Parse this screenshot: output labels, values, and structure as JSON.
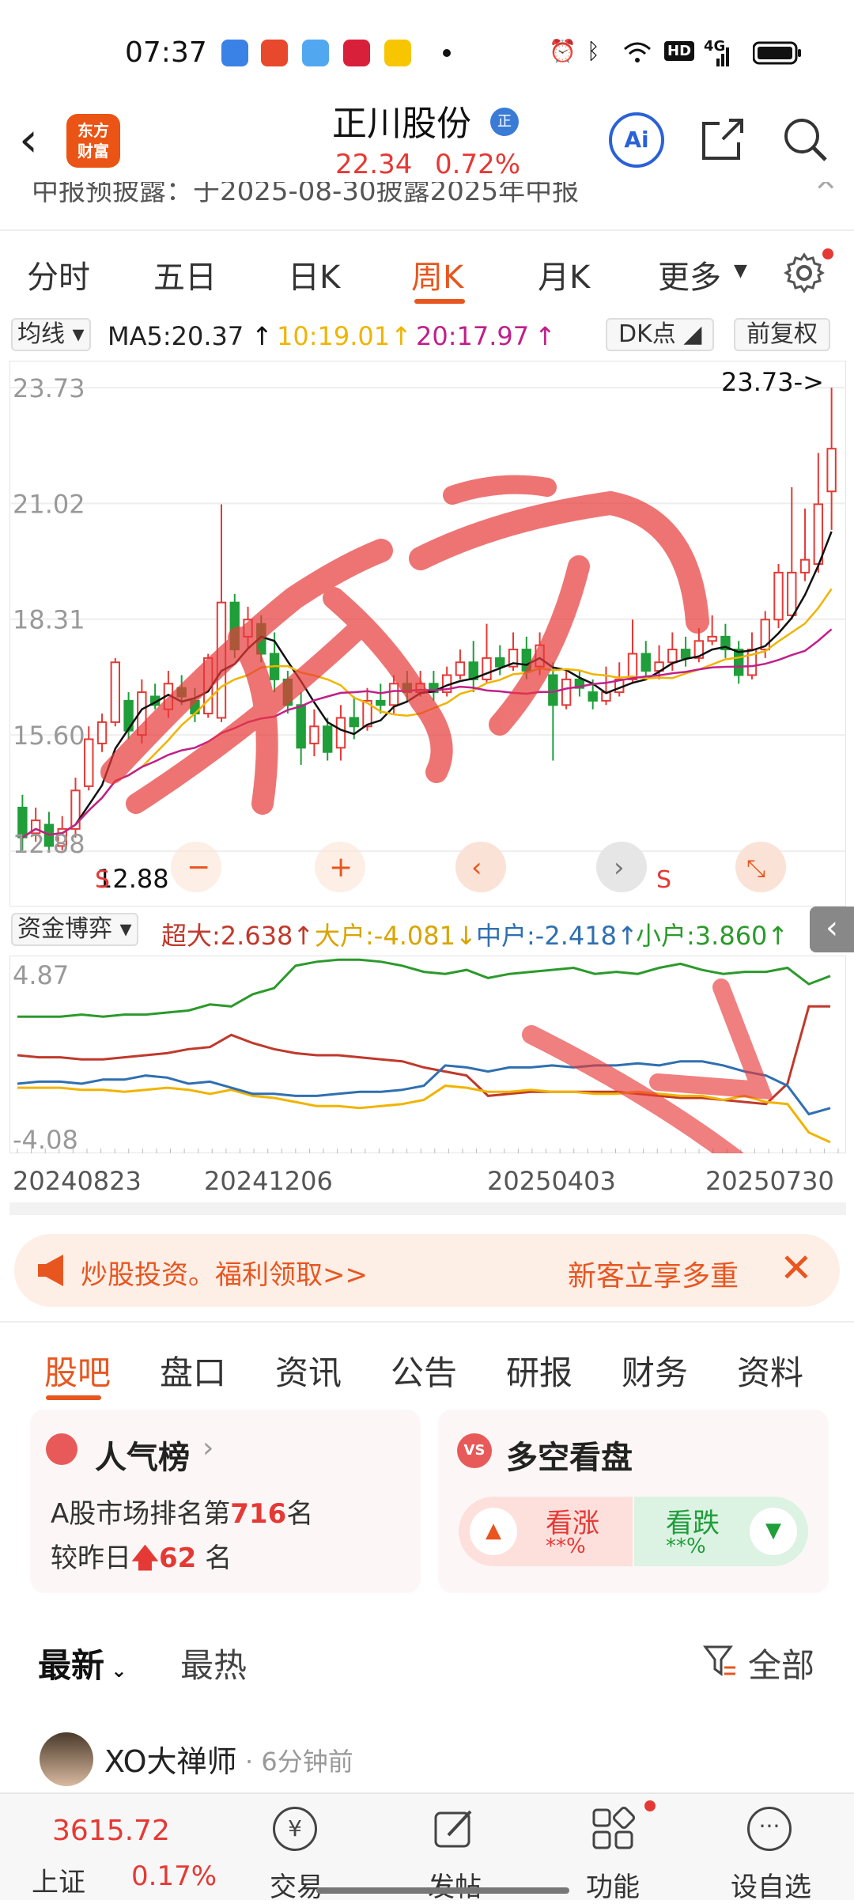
{
  "status_bar": {
    "time": "07:37",
    "hd": "HD",
    "net": "4G"
  },
  "header": {
    "logo_text": "东方\n财富",
    "stock_name": "正川股份",
    "stock_badge": "正",
    "price": "22.34",
    "change_pct": "0.72%",
    "ai_label": "Ai"
  },
  "marquee": {
    "text": "中报预披露：于2025-08-30披露2025年中报"
  },
  "period_tabs": [
    "分时",
    "五日",
    "日K",
    "周K",
    "月K",
    "更多"
  ],
  "active_period": "周K",
  "ma_bar": {
    "selector": "均线",
    "ma5": "MA5:20.37",
    "ma10": "10:19.01",
    "ma20": "20:17.97",
    "dk": "DK点",
    "fq": "前复权"
  },
  "chart_data": [
    {
      "type": "candlestick",
      "title": "",
      "y_ticks": [
        "23.73",
        "21.02",
        "18.31",
        "15.60",
        "12.88"
      ],
      "ylim": [
        12.88,
        23.73
      ],
      "high_marker": "23.73->",
      "low_marker": "12.88",
      "signal_labels": [
        "S",
        "S"
      ],
      "candles": [
        [
          13.9,
          13.2,
          14.2,
          12.9
        ],
        [
          13.3,
          13.6,
          13.9,
          13.1
        ],
        [
          13.5,
          13.0,
          13.8,
          12.9
        ],
        [
          13.0,
          13.4,
          13.7,
          12.9
        ],
        [
          13.4,
          14.3,
          14.6,
          13.2
        ],
        [
          14.4,
          15.5,
          15.8,
          14.3
        ],
        [
          15.4,
          15.9,
          16.1,
          15.2
        ],
        [
          15.9,
          17.3,
          17.4,
          15.8
        ],
        [
          16.4,
          15.7,
          16.6,
          15.5
        ],
        [
          15.6,
          16.6,
          16.9,
          15.4
        ],
        [
          16.5,
          16.3,
          16.8,
          16.2
        ],
        [
          16.2,
          16.8,
          17.1,
          16.0
        ],
        [
          16.7,
          16.5,
          17.0,
          16.3
        ],
        [
          16.4,
          16.1,
          16.7,
          15.9
        ],
        [
          16.1,
          17.4,
          17.5,
          16.0
        ],
        [
          16.0,
          18.7,
          21.0,
          15.9
        ],
        [
          18.7,
          17.6,
          18.9,
          17.4
        ],
        [
          17.9,
          18.3,
          18.6,
          17.6
        ],
        [
          18.2,
          17.5,
          18.4,
          17.3
        ],
        [
          17.5,
          16.9,
          18.0,
          16.6
        ],
        [
          16.9,
          16.3,
          17.1,
          16.1
        ],
        [
          16.3,
          15.3,
          16.6,
          14.9
        ],
        [
          15.4,
          15.8,
          16.2,
          15.1
        ],
        [
          15.8,
          15.2,
          16.0,
          15.0
        ],
        [
          15.3,
          16.0,
          16.3,
          15.0
        ],
        [
          16.0,
          15.8,
          16.5,
          15.5
        ],
        [
          15.8,
          16.4,
          16.7,
          15.7
        ],
        [
          16.4,
          16.3,
          16.8,
          16.1
        ],
        [
          16.3,
          16.8,
          17.0,
          16.1
        ],
        [
          16.8,
          16.6,
          17.1,
          16.4
        ],
        [
          16.6,
          16.8,
          17.1,
          16.5
        ],
        [
          16.8,
          16.6,
          17.1,
          16.4
        ],
        [
          16.6,
          17.0,
          17.2,
          16.5
        ],
        [
          17.0,
          17.3,
          17.6,
          16.9
        ],
        [
          17.3,
          16.9,
          17.8,
          16.6
        ],
        [
          16.9,
          17.4,
          18.2,
          16.8
        ],
        [
          17.4,
          17.2,
          17.7,
          17.0
        ],
        [
          17.2,
          17.6,
          18.0,
          17.1
        ],
        [
          17.6,
          17.1,
          17.9,
          16.9
        ],
        [
          17.2,
          17.7,
          18.0,
          17.0
        ],
        [
          17.0,
          16.3,
          17.3,
          15.0
        ],
        [
          16.3,
          16.9,
          17.1,
          16.2
        ],
        [
          16.9,
          16.7,
          17.1,
          16.5
        ],
        [
          16.6,
          16.4,
          16.9,
          16.2
        ],
        [
          16.4,
          16.6,
          17.2,
          16.3
        ],
        [
          16.6,
          16.9,
          17.3,
          16.5
        ],
        [
          16.9,
          17.5,
          18.3,
          16.8
        ],
        [
          17.5,
          17.1,
          17.8,
          16.9
        ],
        [
          17.1,
          17.3,
          17.7,
          16.9
        ],
        [
          17.3,
          17.6,
          18.0,
          17.1
        ],
        [
          17.6,
          17.4,
          17.9,
          17.2
        ],
        [
          17.4,
          17.8,
          18.1,
          17.3
        ],
        [
          17.8,
          17.9,
          18.4,
          17.7
        ],
        [
          17.9,
          17.6,
          18.2,
          17.4
        ],
        [
          17.6,
          17.0,
          17.8,
          16.8
        ],
        [
          17.0,
          17.6,
          18.0,
          16.9
        ],
        [
          17.6,
          18.3,
          18.5,
          17.4
        ],
        [
          18.3,
          19.4,
          19.6,
          18.1
        ],
        [
          18.4,
          19.4,
          21.4,
          18.3
        ],
        [
          19.4,
          19.7,
          20.9,
          19.2
        ],
        [
          19.6,
          21.0,
          22.2,
          19.4
        ],
        [
          21.3,
          22.3,
          23.73,
          20.4
        ]
      ],
      "ma_lines": [
        {
          "name": "MA5",
          "color": "#111111"
        },
        {
          "name": "MA10",
          "color": "#f0b400"
        },
        {
          "name": "MA20",
          "color": "#c0208a"
        }
      ]
    },
    {
      "type": "line",
      "title": "资金博弈",
      "y_ticks": [
        "4.87",
        "-4.08"
      ],
      "ylim": [
        -4.08,
        4.87
      ],
      "x": [
        "20240823",
        "20241206",
        "20250403",
        "20250730"
      ],
      "series": [
        {
          "name": "超大",
          "value": "2.638",
          "color": "#c0392b",
          "values": [
            0.2,
            0.1,
            0.1,
            0.0,
            0.0,
            0.1,
            0.2,
            0.3,
            0.5,
            0.6,
            1.2,
            0.8,
            0.5,
            0.3,
            0.2,
            0.2,
            0.1,
            0.0,
            -0.1,
            -0.4,
            -0.6,
            -0.8,
            -1.8,
            -1.7,
            -1.6,
            -1.6,
            -1.6,
            -1.6,
            -1.6,
            -1.7,
            -1.8,
            -1.9,
            -1.9,
            -2.0,
            -2.1,
            -2.2,
            -1.2,
            2.6,
            2.6
          ]
        },
        {
          "name": "大户",
          "value": "-4.081",
          "color": "#f0b400",
          "values": [
            -1.4,
            -1.4,
            -1.4,
            -1.5,
            -1.5,
            -1.6,
            -1.5,
            -1.4,
            -1.5,
            -1.7,
            -1.5,
            -1.8,
            -1.9,
            -2.1,
            -2.3,
            -2.3,
            -2.4,
            -2.3,
            -2.2,
            -2.0,
            -1.3,
            -1.4,
            -1.6,
            -1.6,
            -1.5,
            -1.6,
            -1.6,
            -1.7,
            -1.7,
            -1.6,
            -1.7,
            -1.8,
            -1.8,
            -2.0,
            -1.8,
            -2.1,
            -2.2,
            -3.6,
            -4.08
          ]
        },
        {
          "name": "中户",
          "value": "-2.418",
          "color": "#2f6fb0",
          "values": [
            -1.2,
            -1.1,
            -1.1,
            -1.2,
            -1.0,
            -1.0,
            -0.8,
            -0.9,
            -1.2,
            -1.1,
            -1.4,
            -1.7,
            -1.7,
            -1.8,
            -1.8,
            -1.7,
            -1.6,
            -1.6,
            -1.5,
            -1.3,
            -0.3,
            -0.4,
            -0.6,
            -0.4,
            -0.4,
            -0.3,
            -0.4,
            -0.3,
            -0.3,
            -0.2,
            -0.3,
            -0.1,
            -0.1,
            -0.3,
            -0.6,
            -0.8,
            -1.3,
            -2.7,
            -2.4
          ]
        },
        {
          "name": "小户",
          "value": "3.860",
          "color": "#2b9a2b",
          "values": [
            2.1,
            2.1,
            2.1,
            2.2,
            2.1,
            2.2,
            2.2,
            2.3,
            2.4,
            2.7,
            2.6,
            3.2,
            3.5,
            4.6,
            4.8,
            4.9,
            4.9,
            4.8,
            4.6,
            4.3,
            4.2,
            4.4,
            4.0,
            4.2,
            4.3,
            4.4,
            4.5,
            4.2,
            4.3,
            4.2,
            4.5,
            4.7,
            4.4,
            4.2,
            4.3,
            4.3,
            4.5,
            3.7,
            4.1
          ]
        }
      ]
    }
  ],
  "indicator_bar": {
    "selector": "资金博弈"
  },
  "promo": {
    "left_text": "炒股投资。福利领取>>",
    "right_text": "新客立享多重",
    "close": "✕"
  },
  "section_tabs": [
    "股吧",
    "盘口",
    "资讯",
    "公告",
    "研报",
    "财务",
    "资料"
  ],
  "active_section": "股吧",
  "popularity": {
    "title": "人气榜",
    "line1_prefix": "A股市场排名第",
    "rank": "716",
    "line1_suffix": "名",
    "line2_prefix": "较昨日",
    "change": "62",
    "line2_suffix": "名"
  },
  "sentiment": {
    "title": "多空看盘",
    "bull_label": "看涨",
    "bull_value": "**%",
    "bear_label": "看跌",
    "bear_value": "**%"
  },
  "feed_tabs": {
    "latest": "最新",
    "hot": "最热",
    "filter": "全部"
  },
  "post": {
    "user": "XO大禅师",
    "time": "· 6分钟前"
  },
  "bottom_nav": {
    "index_value": "3615.72",
    "index_name": "上证",
    "index_change": "0.17%",
    "trade": "交易",
    "post": "发帖",
    "functions": "功能",
    "watchlist": "设自选"
  },
  "colors": {
    "accent": "#e8561f",
    "up": "#e53935",
    "down": "#1f9e3a"
  }
}
